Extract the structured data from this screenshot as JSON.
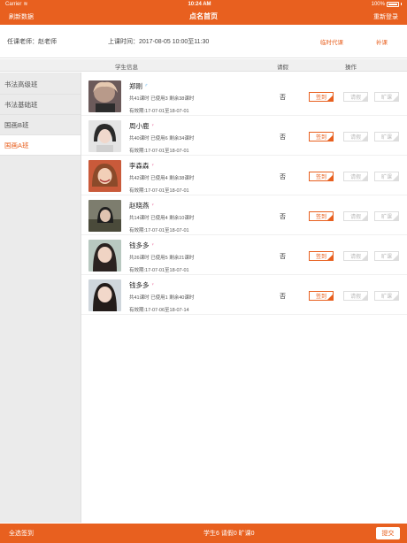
{
  "status_bar": {
    "carrier": "Carrier",
    "time": "10:24 AM",
    "battery": "100%"
  },
  "nav": {
    "left": "刷新数据",
    "title": "点名首页",
    "right": "重新登录"
  },
  "info": {
    "teacher": "任课老师：赵老师",
    "time": "上课时间：2017-08-05 10:00至11:30",
    "temp_teacher": "临时代课",
    "makeup": "补课"
  },
  "table_header": {
    "student": "学生信息",
    "leave": "请假",
    "ops": "操作"
  },
  "sidebar": {
    "items": [
      {
        "label": "书法高级班",
        "active": false
      },
      {
        "label": "书法基础班",
        "active": false
      },
      {
        "label": "国画B班",
        "active": false
      },
      {
        "label": "国画A班",
        "active": true
      }
    ]
  },
  "ops_labels": {
    "sign": "签到",
    "leave": "请假",
    "absent": "旷课"
  },
  "students": [
    {
      "name": "郑刚",
      "gender": "male",
      "gender_icon": "♂",
      "hours": "共41课时 已使用3 剩余38课时",
      "valid": "有效期:17-07-01至18-07-01",
      "leave": "否",
      "avatar": "dark-hair-male"
    },
    {
      "name": "周小鹿",
      "gender": "female",
      "gender_icon": "♀",
      "hours": "共40课时 已使用6 剩余34课时",
      "valid": "有效期:17-07-01至18-07-01",
      "leave": "否",
      "avatar": "short-hair-female"
    },
    {
      "name": "李森森",
      "gender": "female",
      "gender_icon": "♀",
      "hours": "共42课时 已使用4 剩余38课时",
      "valid": "有效期:17-07-01至18-07-01",
      "leave": "否",
      "avatar": "smiling-female"
    },
    {
      "name": "赵晓燕",
      "gender": "female",
      "gender_icon": "♀",
      "hours": "共14课时 已使用4 剩余10课时",
      "valid": "有效期:17-07-01至18-07-01",
      "leave": "否",
      "avatar": "outdoor-female"
    },
    {
      "name": "钱多多",
      "gender": "female",
      "gender_icon": "♀",
      "hours": "共26课时 已使用5 剩余21课时",
      "valid": "有效期:17-07-01至18-07-01",
      "leave": "否",
      "avatar": "long-hair-female"
    },
    {
      "name": "钱多多",
      "gender": "female",
      "gender_icon": "♀",
      "hours": "共41课时 已使用1 剩余40课时",
      "valid": "有效期:17-07-06至18-07-14",
      "leave": "否",
      "avatar": "long-hair-female-2"
    }
  ],
  "bottom": {
    "all_sign": "全选签到",
    "stats": "学生6  请假0  旷课0",
    "submit": "提交"
  },
  "colors": {
    "accent": "#e8601f",
    "male": "#3aa0e8",
    "female": "#e8508a"
  }
}
